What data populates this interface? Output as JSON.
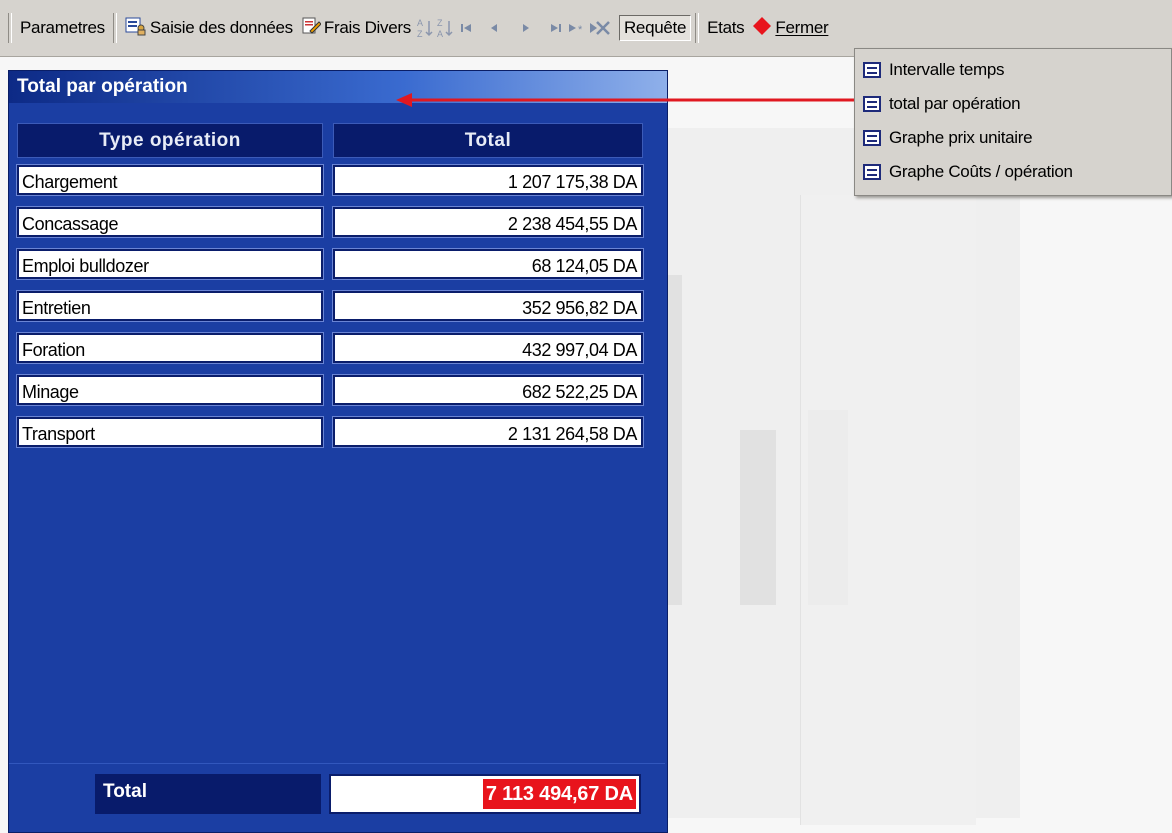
{
  "toolbar": {
    "parametres": "Parametres",
    "saisie": "Saisie des données",
    "frais": "Frais Divers",
    "requete": "Requête",
    "etats": "Etats",
    "fermer": "Fermer"
  },
  "window": {
    "title": "Total par opération",
    "columns": [
      "Type opération",
      "Total"
    ],
    "rows": [
      {
        "type": "Chargement",
        "total": "1 207 175,38 DA"
      },
      {
        "type": "Concassage",
        "total": "2 238 454,55 DA"
      },
      {
        "type": "Emploi bulldozer",
        "total": "68 124,05 DA"
      },
      {
        "type": "Entretien",
        "total": "352 956,82 DA"
      },
      {
        "type": "Foration",
        "total": "432 997,04 DA"
      },
      {
        "type": "Minage",
        "total": "682 522,25 DA"
      },
      {
        "type": "Transport",
        "total": "2 131 264,58 DA"
      }
    ],
    "footer": {
      "label": "Total",
      "value": "7 113 494,67 DA"
    }
  },
  "menu": {
    "items": [
      "Intervalle temps",
      "total par opération",
      "Graphe prix unitaire",
      "Graphe Coûts / opération"
    ]
  },
  "colors": {
    "window_bg": "#1b3ea3",
    "header_bg": "#081b6b",
    "total_highlight": "#e8141c",
    "arrow": "#e01820"
  },
  "icons": [
    "form-icon",
    "edit-icon",
    "sort-asc-icon",
    "sort-desc-icon",
    "first-record-icon",
    "prev-record-icon",
    "next-record-icon",
    "last-record-icon",
    "new-record-icon",
    "delete-record-icon",
    "close-diamond-icon"
  ]
}
